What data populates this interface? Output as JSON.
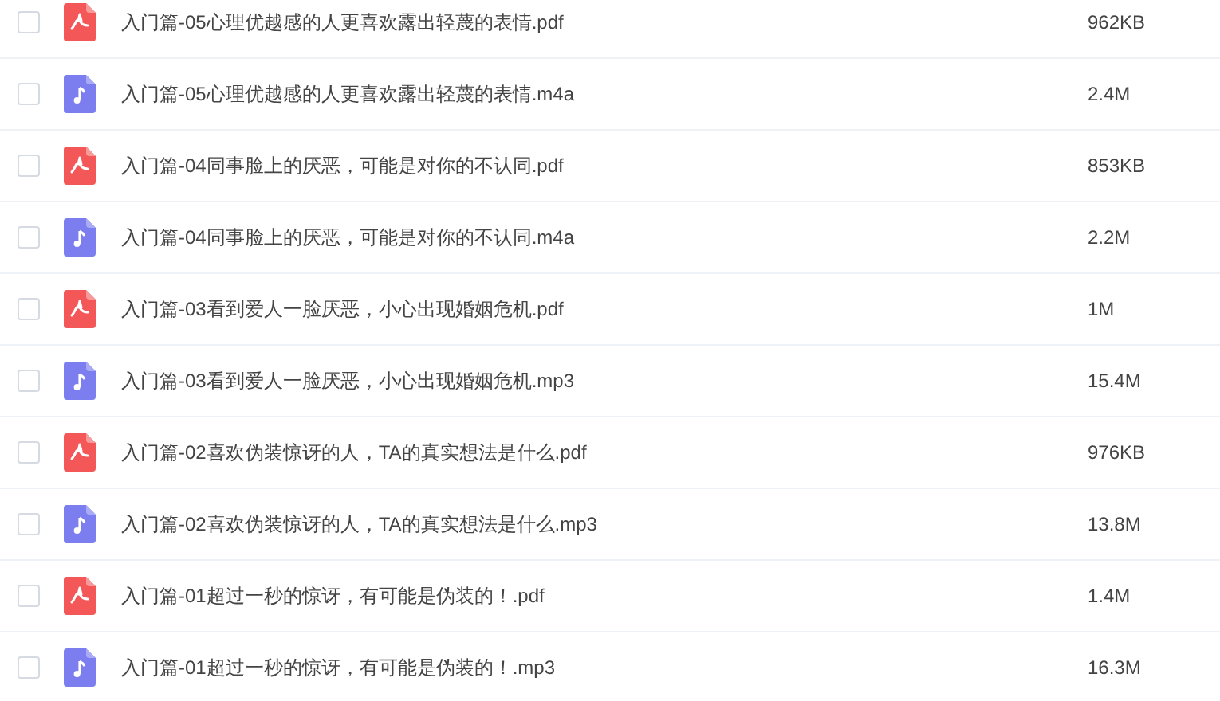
{
  "files": [
    {
      "kind": "pdf",
      "name": "入门篇-05心理优越感的人更喜欢露出轻蔑的表情.pdf",
      "size": "962KB",
      "checked": false
    },
    {
      "kind": "audio",
      "name": "入门篇-05心理优越感的人更喜欢露出轻蔑的表情.m4a",
      "size": "2.4M",
      "checked": false
    },
    {
      "kind": "pdf",
      "name": "入门篇-04同事脸上的厌恶，可能是对你的不认同.pdf",
      "size": "853KB",
      "checked": false
    },
    {
      "kind": "audio",
      "name": "入门篇-04同事脸上的厌恶，可能是对你的不认同.m4a",
      "size": "2.2M",
      "checked": false
    },
    {
      "kind": "pdf",
      "name": "入门篇-03看到爱人一脸厌恶，小心出现婚姻危机.pdf",
      "size": "1M",
      "checked": false
    },
    {
      "kind": "audio",
      "name": "入门篇-03看到爱人一脸厌恶，小心出现婚姻危机.mp3",
      "size": "15.4M",
      "checked": false
    },
    {
      "kind": "pdf",
      "name": "入门篇-02喜欢伪装惊讶的人，TA的真实想法是什么.pdf",
      "size": "976KB",
      "checked": false
    },
    {
      "kind": "audio",
      "name": "入门篇-02喜欢伪装惊讶的人，TA的真实想法是什么.mp3",
      "size": "13.8M",
      "checked": false
    },
    {
      "kind": "pdf",
      "name": "入门篇-01超过一秒的惊讶，有可能是伪装的！.pdf",
      "size": "1.4M",
      "checked": false
    },
    {
      "kind": "audio",
      "name": "入门篇-01超过一秒的惊讶，有可能是伪装的！.mp3",
      "size": "16.3M",
      "checked": false
    }
  ]
}
